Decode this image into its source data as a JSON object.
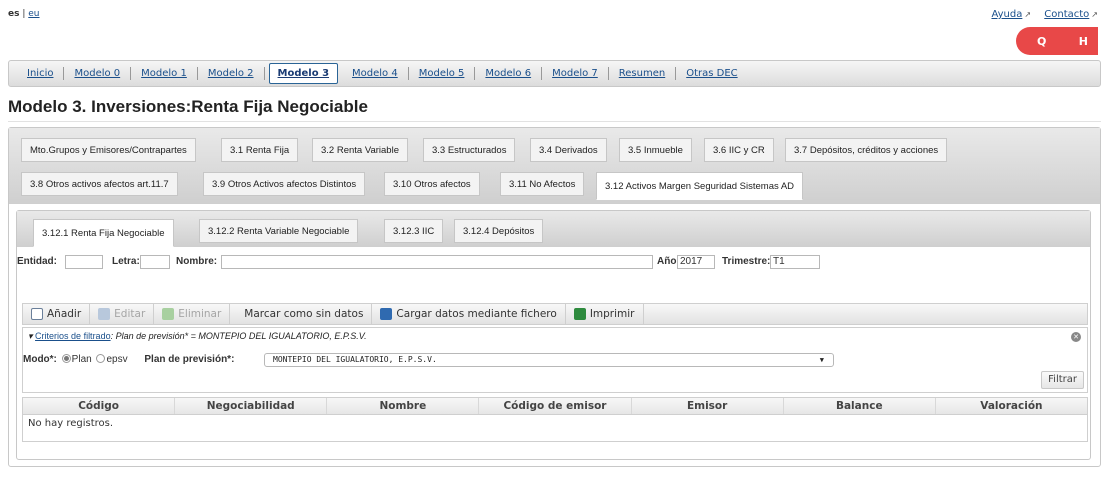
{
  "lang": {
    "current": "es",
    "sep": "|",
    "other": "eu"
  },
  "toplinks": {
    "help": "Ayuda",
    "contact": "Contacto",
    "ext_glyph": "↗"
  },
  "badge": {
    "left": "Q",
    "right": "H",
    "color": "#e84848"
  },
  "mainnav": [
    "Inicio",
    "Modelo 0",
    "Modelo 1",
    "Modelo 2",
    "Modelo 3",
    "Modelo 4",
    "Modelo 5",
    "Modelo 6",
    "Modelo 7",
    "Resumen",
    "Otras DEC"
  ],
  "mainnav_active": "Modelo 3",
  "page_title": "Modelo 3. Inversiones:Renta Fija Negociable",
  "outer_tabs_row1": [
    "Mto.Grupos y Emisores/Contrapartes",
    "3.1 Renta Fija",
    "3.2 Renta Variable",
    "3.3 Estructurados",
    "3.4 Derivados",
    "3.5 Inmueble",
    "3.6 IIC y CR",
    "3.7 Depósitos, créditos y acciones"
  ],
  "outer_tabs_row2": [
    "3.8 Otros activos afectos art.11.7",
    "3.9 Otros Activos afectos Distintos",
    "3.10 Otros afectos",
    "3.11 No Afectos",
    "3.12 Activos Margen Seguridad Sistemas AD"
  ],
  "inner_tabs": [
    "3.12.1 Renta Fija Negociable",
    "3.12.2 Renta Variable Negociable",
    "3.12.3 IIC",
    "3.12.4 Depósitos"
  ],
  "filters": {
    "entidad_label": "Entidad:",
    "entidad_value": "",
    "letra_label": "Letra:",
    "letra_value": "",
    "nombre_label": "Nombre:",
    "nombre_value": "",
    "anio_label": "Año:",
    "anio_value": "2017",
    "trimestre_label": "Trimestre:",
    "trimestre_value": "T1"
  },
  "toolbar": {
    "add": "Añadir",
    "edit": "Editar",
    "delete": "Eliminar",
    "nodata": "Marcar como sin datos",
    "upload": "Cargar datos mediante fichero",
    "print": "Imprimir"
  },
  "criteria": {
    "arrow": "▾",
    "link": "Criterios de filtrado",
    "text": ": Plan de previsión* = MONTEPIO DEL IGUALATORIO, E.P.S.V.",
    "modo_label": "Modo*:",
    "opt_plan": "Plan",
    "opt_epsv": "epsv",
    "plan_label": "Plan de previsión*:",
    "plan_value": "MONTEPIO DEL IGUALATORIO, E.P.S.V.",
    "filter_button": "Filtrar"
  },
  "grid": {
    "columns": [
      "Código",
      "Negociabilidad",
      "Nombre",
      "Código de emisor",
      "Emisor",
      "Balance",
      "Valoración"
    ],
    "empty": "No hay registros."
  }
}
